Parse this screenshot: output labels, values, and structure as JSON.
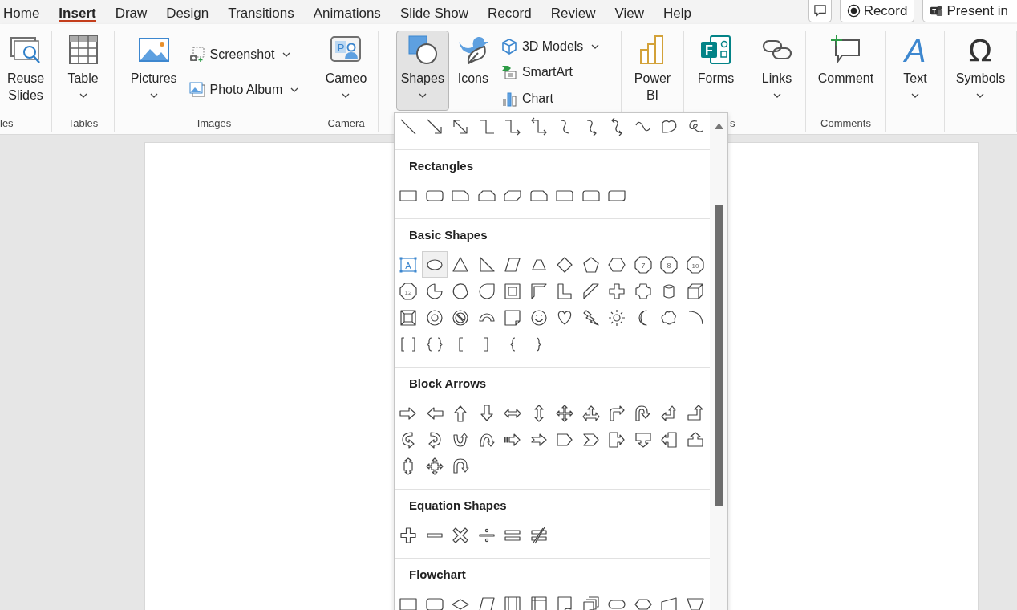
{
  "tabs": [
    {
      "label": "Home",
      "selected": false
    },
    {
      "label": "Insert",
      "selected": true
    },
    {
      "label": "Draw",
      "selected": false
    },
    {
      "label": "Design",
      "selected": false
    },
    {
      "label": "Transitions",
      "selected": false
    },
    {
      "label": "Animations",
      "selected": false
    },
    {
      "label": "Slide Show",
      "selected": false
    },
    {
      "label": "Record",
      "selected": false
    },
    {
      "label": "Review",
      "selected": false
    },
    {
      "label": "View",
      "selected": false
    },
    {
      "label": "Help",
      "selected": false
    }
  ],
  "quick_actions": [
    {
      "kind": "comment"
    },
    {
      "kind": "record",
      "label": "Record"
    },
    {
      "kind": "present",
      "label": "Present in"
    }
  ],
  "ribbon": {
    "groups": [
      {
        "label": "les",
        "items": [
          {
            "kind": "large",
            "label": "Reuse Slides",
            "dropdown": false,
            "pressed": false
          }
        ]
      },
      {
        "label": "Tables",
        "items": [
          {
            "kind": "large",
            "label": "Table",
            "dropdown": true,
            "pressed": false
          }
        ]
      },
      {
        "label": "Images",
        "items": [
          {
            "kind": "large",
            "label": "Pictures",
            "dropdown": true,
            "pressed": false
          },
          {
            "kind": "small",
            "label": "Screenshot",
            "dropdown": true,
            "pressed": false
          },
          {
            "kind": "small",
            "label": "Photo Album",
            "dropdown": true,
            "pressed": false
          }
        ]
      },
      {
        "label": "Camera",
        "items": [
          {
            "kind": "large",
            "label": "Cameo",
            "dropdown": true,
            "pressed": false,
            "icon_text": "P"
          }
        ]
      },
      {
        "items": [
          {
            "kind": "large",
            "label": "Shapes",
            "dropdown": true,
            "pressed": true
          },
          {
            "kind": "large",
            "label": "Icons",
            "dropdown": false,
            "pressed": false
          },
          {
            "kind": "small",
            "label": "3D Models",
            "dropdown": true,
            "pressed": false
          },
          {
            "kind": "small",
            "label": "SmartArt",
            "dropdown": false,
            "pressed": false
          },
          {
            "kind": "small",
            "label": "Chart",
            "dropdown": false,
            "pressed": false
          }
        ]
      },
      {
        "items": [
          {
            "kind": "large",
            "label": "Power BI",
            "dropdown": false,
            "pressed": false
          }
        ]
      },
      {
        "label": "s",
        "items": [
          {
            "kind": "large",
            "label": "Forms",
            "dropdown": false,
            "pressed": false,
            "icon_text": "F"
          }
        ]
      },
      {
        "items": [
          {
            "kind": "large",
            "label": "Links",
            "dropdown": true,
            "pressed": false
          }
        ]
      },
      {
        "label": "Comments",
        "items": [
          {
            "kind": "large",
            "label": "Comment",
            "dropdown": false,
            "pressed": false
          }
        ]
      },
      {
        "items": [
          {
            "kind": "large",
            "label": "Text",
            "dropdown": true,
            "pressed": false,
            "icon_text": "A"
          }
        ]
      },
      {
        "items": [
          {
            "kind": "large",
            "label": "Symbols",
            "dropdown": true,
            "pressed": false,
            "icon_text": "Ω"
          }
        ]
      }
    ]
  },
  "shapes_gallery": {
    "sections": [
      {
        "shapes": [
          {
            "kind": "line",
            "selected": false
          },
          {
            "kind": "arrow",
            "selected": false
          },
          {
            "kind": "double-arrow",
            "selected": false
          },
          {
            "kind": "elbow-connector",
            "selected": false
          },
          {
            "kind": "elbow-arrow",
            "selected": false
          },
          {
            "kind": "elbow-double-arrow",
            "selected": false
          },
          {
            "kind": "curved-connector",
            "selected": false
          },
          {
            "kind": "curved-arrow",
            "selected": false
          },
          {
            "kind": "curved-double-arrow",
            "selected": false
          },
          {
            "kind": "curve",
            "selected": false
          },
          {
            "kind": "freeform",
            "selected": false
          },
          {
            "kind": "scribble",
            "selected": false
          }
        ]
      },
      {
        "heading": "Rectangles",
        "shapes": [
          {
            "kind": "rectangle",
            "selected": false
          },
          {
            "kind": "rounded-rectangle",
            "selected": false
          },
          {
            "kind": "snip-corner-rectangle",
            "selected": false
          },
          {
            "kind": "snip-same-side-rectangle",
            "selected": false
          },
          {
            "kind": "snip-diagonal-rectangle",
            "selected": false
          },
          {
            "kind": "snip-round-rectangle",
            "selected": false
          },
          {
            "kind": "round-corner-rectangle",
            "selected": false
          },
          {
            "kind": "round-same-side-rectangle",
            "selected": false
          },
          {
            "kind": "round-diagonal-rectangle",
            "selected": false
          }
        ]
      },
      {
        "heading": "Basic Shapes",
        "shapes": [
          {
            "kind": "text-box",
            "label": "A",
            "selected": false
          },
          {
            "kind": "oval",
            "selected": true
          },
          {
            "kind": "triangle",
            "selected": false
          },
          {
            "kind": "right-triangle",
            "selected": false
          },
          {
            "kind": "parallelogram",
            "selected": false
          },
          {
            "kind": "trapezoid",
            "selected": false
          },
          {
            "kind": "diamond",
            "selected": false
          },
          {
            "kind": "pentagon",
            "selected": false
          },
          {
            "kind": "hexagon",
            "selected": false
          },
          {
            "kind": "polygon",
            "label": "7",
            "selected": false
          },
          {
            "kind": "polygon",
            "label": "8",
            "selected": false
          },
          {
            "kind": "polygon",
            "label": "10",
            "selected": false
          },
          {
            "kind": "polygon",
            "label": "12",
            "selected": false
          },
          {
            "kind": "pie",
            "selected": false
          },
          {
            "kind": "chord",
            "selected": false
          },
          {
            "kind": "teardrop",
            "selected": false
          },
          {
            "kind": "frame",
            "selected": false
          },
          {
            "kind": "half-frame",
            "selected": false
          },
          {
            "kind": "l-shape",
            "selected": false
          },
          {
            "kind": "diagonal-stripe",
            "selected": false
          },
          {
            "kind": "cross",
            "selected": false
          },
          {
            "kind": "plaque",
            "selected": false
          },
          {
            "kind": "can",
            "selected": false
          },
          {
            "kind": "cube",
            "selected": false
          },
          {
            "kind": "bevel",
            "selected": false
          },
          {
            "kind": "donut",
            "selected": false
          },
          {
            "kind": "no-symbol",
            "selected": false
          },
          {
            "kind": "block-arc",
            "selected": false
          },
          {
            "kind": "folded-corner",
            "selected": false
          },
          {
            "kind": "smiley-face",
            "selected": false
          },
          {
            "kind": "heart",
            "selected": false
          },
          {
            "kind": "lightning-bolt",
            "selected": false
          },
          {
            "kind": "sun",
            "selected": false
          },
          {
            "kind": "moon",
            "selected": false
          },
          {
            "kind": "cloud",
            "selected": false
          },
          {
            "kind": "arc",
            "selected": false
          },
          {
            "kind": "double-bracket",
            "selected": false
          },
          {
            "kind": "double-brace",
            "selected": false
          },
          {
            "kind": "left-bracket",
            "selected": false
          },
          {
            "kind": "right-bracket",
            "selected": false
          },
          {
            "kind": "left-brace",
            "selected": false
          },
          {
            "kind": "right-brace",
            "selected": false
          }
        ]
      },
      {
        "heading": "Block Arrows",
        "shapes": [
          {
            "kind": "right-arrow",
            "selected": false
          },
          {
            "kind": "left-arrow",
            "selected": false
          },
          {
            "kind": "up-arrow",
            "selected": false
          },
          {
            "kind": "down-arrow",
            "selected": false
          },
          {
            "kind": "left-right-arrow",
            "selected": false
          },
          {
            "kind": "up-down-arrow",
            "selected": false
          },
          {
            "kind": "quad-arrow",
            "selected": false
          },
          {
            "kind": "left-right-up-arrow",
            "selected": false
          },
          {
            "kind": "bent-arrow",
            "selected": false
          },
          {
            "kind": "u-turn-arrow",
            "selected": false
          },
          {
            "kind": "left-up-arrow",
            "selected": false
          },
          {
            "kind": "bent-up-arrow",
            "selected": false
          },
          {
            "kind": "curved-right-arrow",
            "selected": false
          },
          {
            "kind": "curved-left-arrow",
            "selected": false
          },
          {
            "kind": "curved-up-arrow",
            "selected": false
          },
          {
            "kind": "curved-down-arrow",
            "selected": false
          },
          {
            "kind": "striped-right-arrow",
            "selected": false
          },
          {
            "kind": "notched-right-arrow",
            "selected": false
          },
          {
            "kind": "pentagon-arrow",
            "selected": false
          },
          {
            "kind": "chevron-arrow",
            "selected": false
          },
          {
            "kind": "right-arrow-callout",
            "selected": false
          },
          {
            "kind": "down-arrow-callout",
            "selected": false
          },
          {
            "kind": "left-arrow-callout",
            "selected": false
          },
          {
            "kind": "up-arrow-callout",
            "selected": false
          },
          {
            "kind": "up-down-arrow-callout",
            "selected": false
          },
          {
            "kind": "quad-arrow-callout",
            "selected": false
          },
          {
            "kind": "circular-arrow",
            "selected": false
          }
        ]
      },
      {
        "heading": "Equation Shapes",
        "shapes": [
          {
            "kind": "plus-sign",
            "selected": false
          },
          {
            "kind": "minus-sign",
            "selected": false
          },
          {
            "kind": "multiply-sign",
            "selected": false
          },
          {
            "kind": "divide-sign",
            "selected": false
          },
          {
            "kind": "equal-sign",
            "selected": false
          },
          {
            "kind": "not-equal-sign",
            "selected": false
          }
        ]
      },
      {
        "heading": "Flowchart",
        "shapes": [
          {
            "kind": "process",
            "selected": false
          },
          {
            "kind": "alternate-process",
            "selected": false
          },
          {
            "kind": "decision",
            "selected": false
          },
          {
            "kind": "data",
            "selected": false
          },
          {
            "kind": "predefined-process",
            "selected": false
          },
          {
            "kind": "internal-storage",
            "selected": false
          },
          {
            "kind": "document",
            "selected": false
          },
          {
            "kind": "multidocument",
            "selected": false
          },
          {
            "kind": "terminator",
            "selected": false
          },
          {
            "kind": "preparation",
            "selected": false
          },
          {
            "kind": "manual-input",
            "selected": false
          },
          {
            "kind": "manual-operation",
            "selected": false
          }
        ]
      }
    ]
  }
}
